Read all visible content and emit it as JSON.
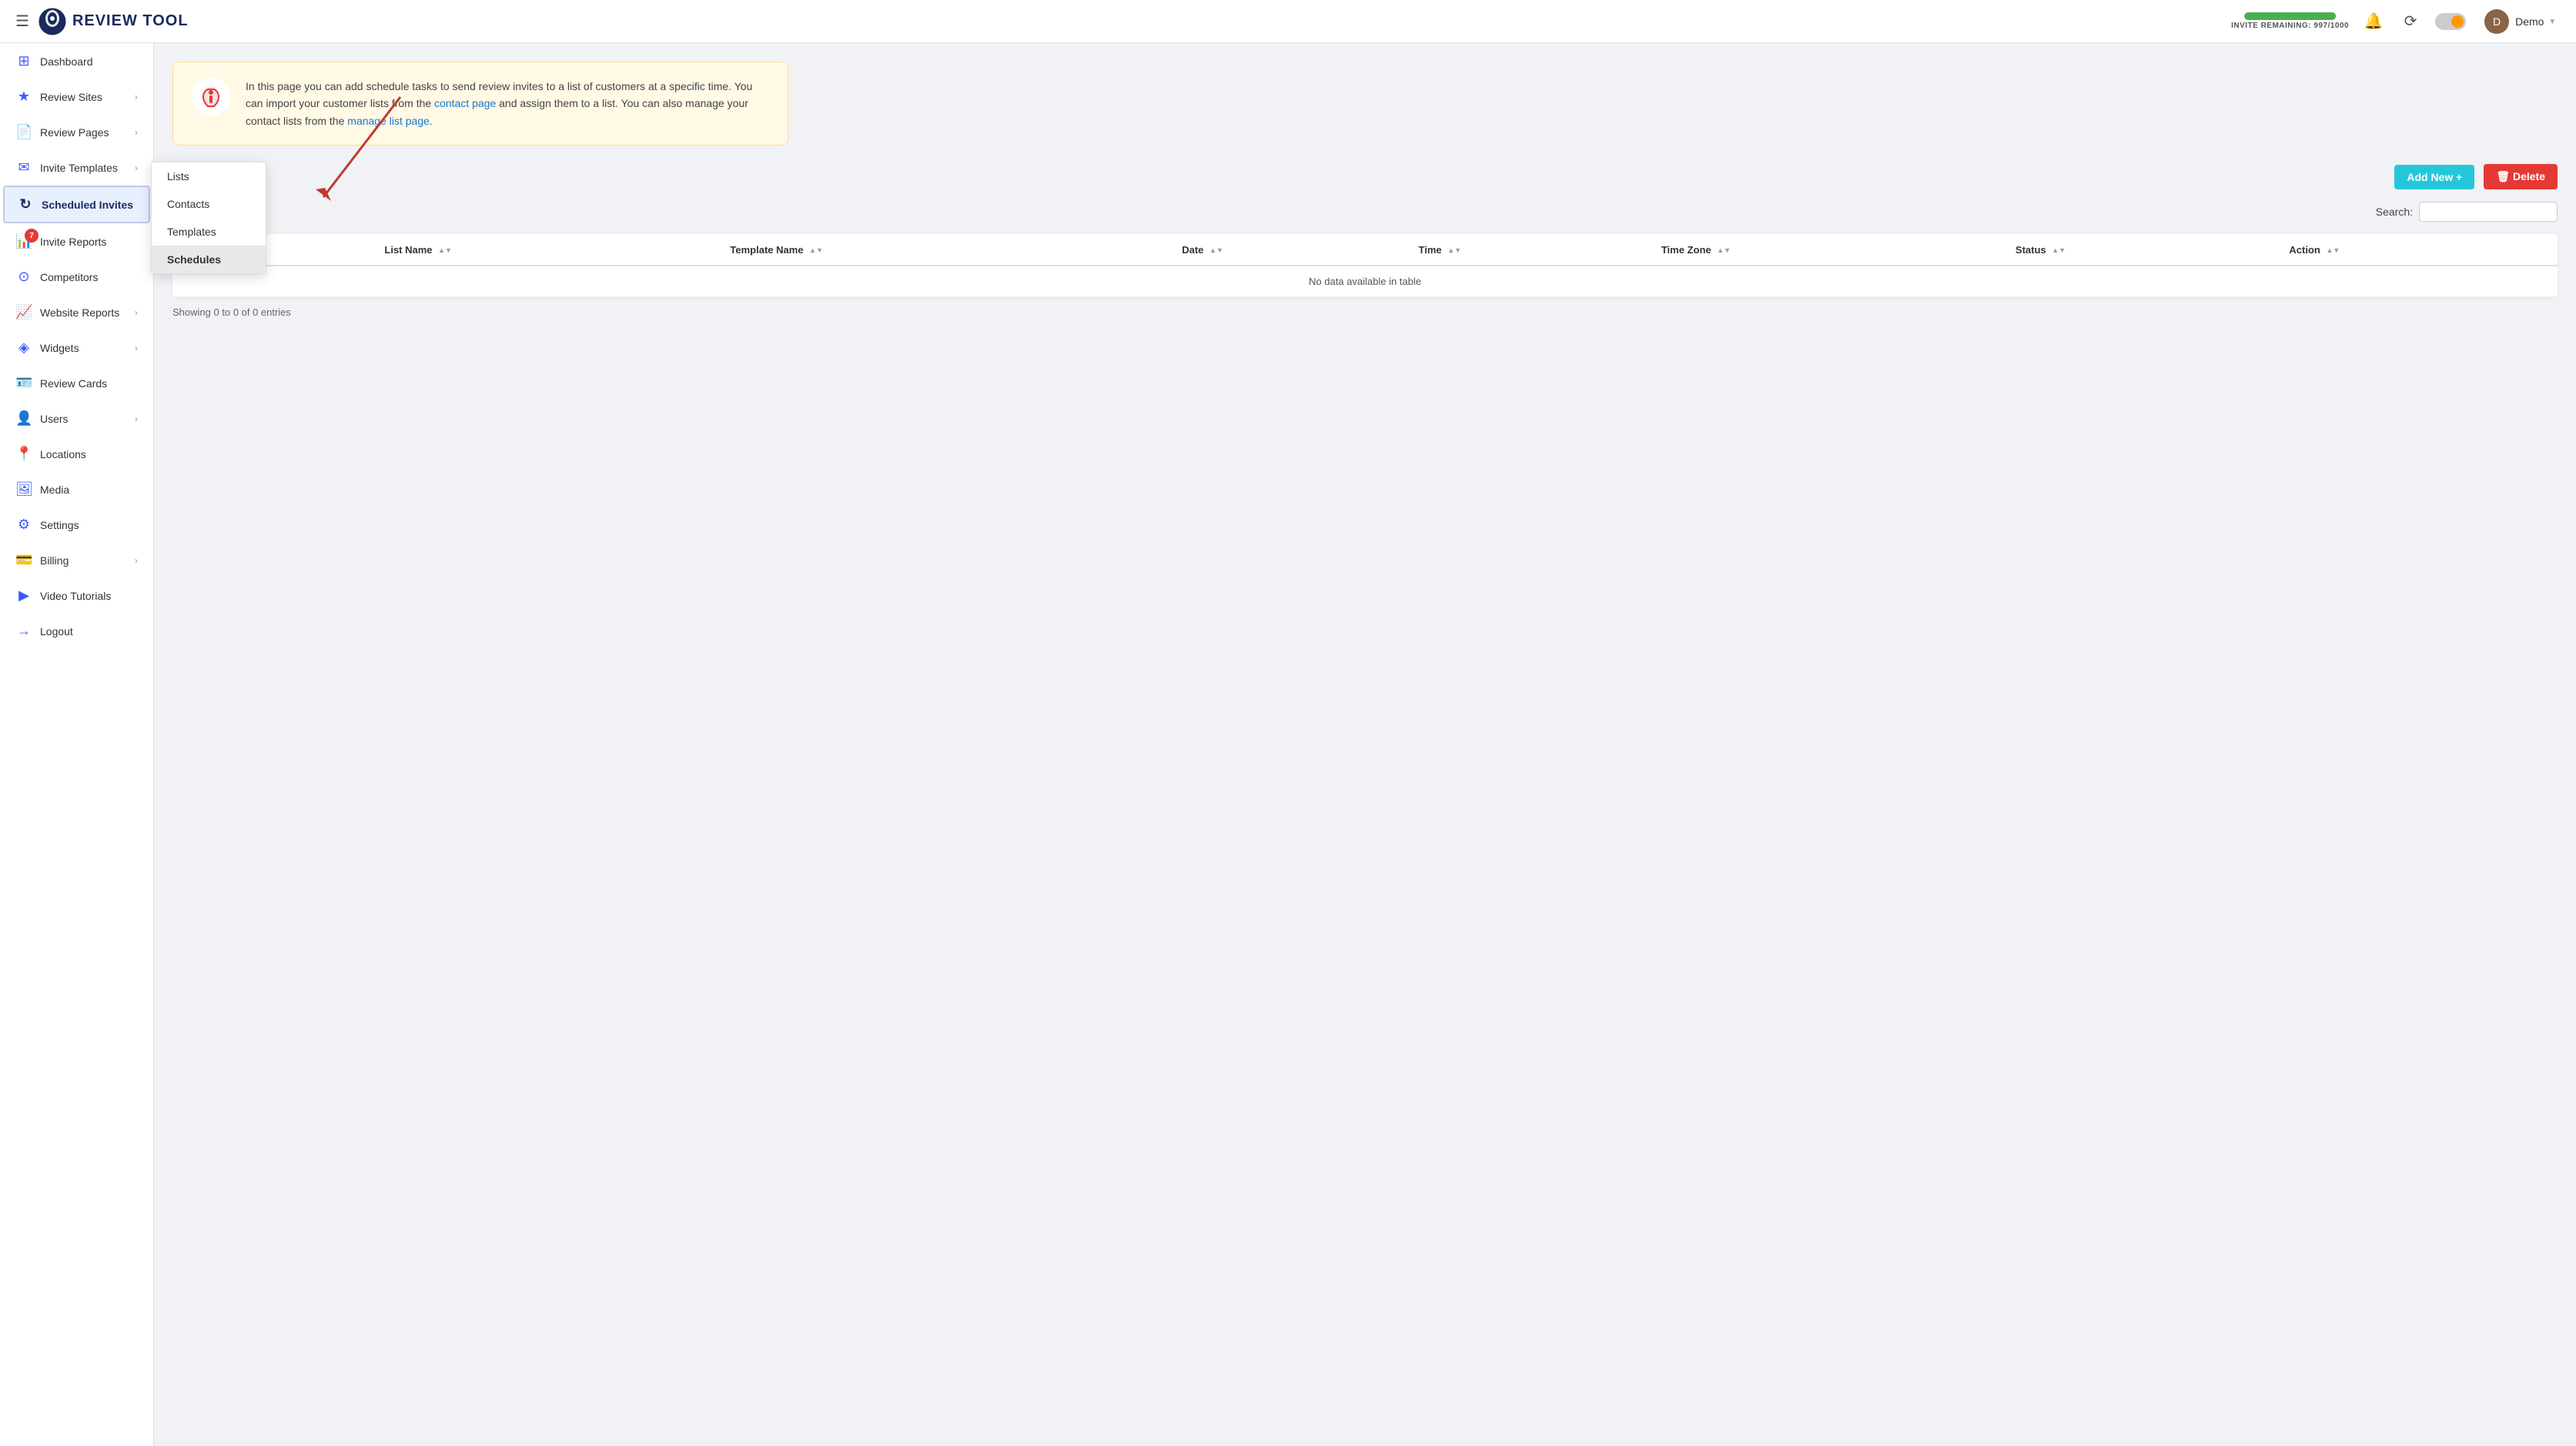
{
  "header": {
    "hamburger_label": "☰",
    "logo_text": "Review Tool",
    "invite_label": "INVITE REMAINING: 997/1000",
    "invite_progress": 99.7,
    "user_name": "Demo",
    "user_initial": "D"
  },
  "sidebar": {
    "items": [
      {
        "id": "dashboard",
        "label": "Dashboard",
        "icon": "⊞",
        "has_chevron": false,
        "has_badge": false
      },
      {
        "id": "review-sites",
        "label": "Review Sites",
        "icon": "★",
        "has_chevron": true,
        "has_badge": false
      },
      {
        "id": "review-pages",
        "label": "Review Pages",
        "icon": "📄",
        "has_chevron": true,
        "has_badge": false
      },
      {
        "id": "invite-templates",
        "label": "Invite Templates",
        "icon": "✉",
        "has_chevron": true,
        "has_badge": false
      },
      {
        "id": "scheduled-invites",
        "label": "Scheduled Invites",
        "icon": "↻",
        "has_chevron": false,
        "has_badge": false,
        "active": true
      },
      {
        "id": "invite-reports",
        "label": "Invite Reports",
        "icon": "📊",
        "has_chevron": false,
        "has_badge": true,
        "badge_count": "7"
      },
      {
        "id": "competitors",
        "label": "Competitors",
        "icon": "⊙",
        "has_chevron": false,
        "has_badge": false
      },
      {
        "id": "website-reports",
        "label": "Website Reports",
        "icon": "📈",
        "has_chevron": true,
        "has_badge": false
      },
      {
        "id": "widgets",
        "label": "Widgets",
        "icon": "◈",
        "has_chevron": true,
        "has_badge": false
      },
      {
        "id": "review-cards",
        "label": "Review Cards",
        "icon": "🪪",
        "has_chevron": false,
        "has_badge": false
      },
      {
        "id": "users",
        "label": "Users",
        "icon": "👤",
        "has_chevron": true,
        "has_badge": false
      },
      {
        "id": "locations",
        "label": "Locations",
        "icon": "📍",
        "has_chevron": false,
        "has_badge": false
      },
      {
        "id": "media",
        "label": "Media",
        "icon": "🖼",
        "has_chevron": false,
        "has_badge": false
      },
      {
        "id": "settings",
        "label": "Settings",
        "icon": "⚙",
        "has_chevron": false,
        "has_badge": false
      },
      {
        "id": "billing",
        "label": "Billing",
        "icon": "💳",
        "has_chevron": true,
        "has_badge": false
      },
      {
        "id": "video-tutorials",
        "label": "Video Tutorials",
        "icon": "▶",
        "has_chevron": false,
        "has_badge": false
      },
      {
        "id": "logout",
        "label": "Logout",
        "icon": "→",
        "has_chevron": false,
        "has_badge": false
      }
    ]
  },
  "submenu": {
    "visible": true,
    "items": [
      {
        "id": "lists",
        "label": "Lists",
        "active": false
      },
      {
        "id": "contacts",
        "label": "Contacts",
        "active": false
      },
      {
        "id": "templates",
        "label": "Templates",
        "active": false
      },
      {
        "id": "schedules",
        "label": "Schedules",
        "active": true
      }
    ]
  },
  "main": {
    "info_banner": {
      "text_before_link1": "In this page you can add schedule tasks to send review invites to a list of customers at a specific time. You can import your customer lists from the ",
      "link1_text": "contact page",
      "text_between": " and assign them to a list. You can also manage your contact lists from the ",
      "link2_text": "manage list page.",
      "text_after": ""
    },
    "toolbar": {
      "add_new_label": "Add New +",
      "delete_label": "🗑 Delete"
    },
    "search": {
      "label": "Search:",
      "placeholder": ""
    },
    "table": {
      "columns": [
        {
          "id": "checkbox",
          "label": ""
        },
        {
          "id": "number",
          "label": "#"
        },
        {
          "id": "list-name",
          "label": "List Name"
        },
        {
          "id": "template-name",
          "label": "Template Name"
        },
        {
          "id": "date",
          "label": "Date"
        },
        {
          "id": "time",
          "label": "Time"
        },
        {
          "id": "timezone",
          "label": "Time Zone"
        },
        {
          "id": "status",
          "label": "Status"
        },
        {
          "id": "action",
          "label": "Action"
        }
      ],
      "rows": [],
      "empty_message": "No data available in table",
      "pagination_info": "Showing 0 to 0 of 0 entries"
    }
  }
}
